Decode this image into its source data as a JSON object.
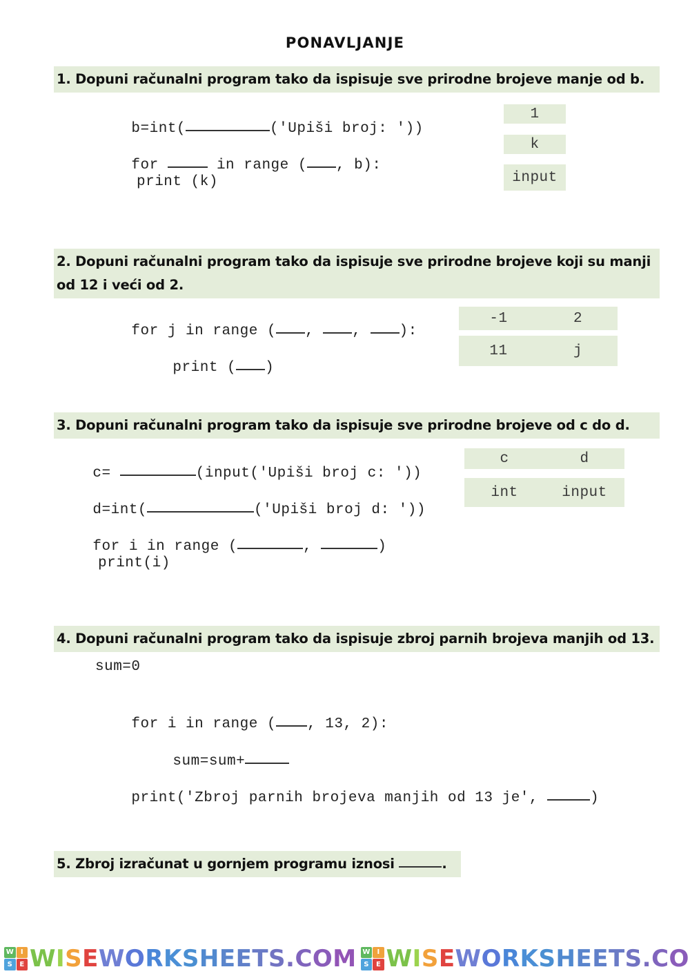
{
  "document": {
    "title": "PONAVLJANJE"
  },
  "questions": [
    {
      "id": "q1",
      "heading": "1. Dopuni računalni program tako da ispisuje sve prirodne brojeve manje od b.",
      "code": [
        {
          "pre": "b=int(",
          "blank": 1,
          "post": "('Upiši broj: '))"
        },
        {
          "pre": "for ",
          "blank": 2,
          "mid": " in range (",
          "blank2": 3,
          "post": ", b):"
        },
        {
          "pre": "    print (k)"
        }
      ],
      "answers": [
        "1",
        "k",
        "input"
      ]
    },
    {
      "id": "q2",
      "heading": "2. Dopuni računalni program tako da ispisuje sve prirodne brojeve koji su manji od 12 i veći od 2.",
      "answers_rows": [
        [
          "-1",
          "2"
        ],
        [
          "11",
          "j"
        ]
      ]
    },
    {
      "id": "q3",
      "heading": "3. Dopuni računalni program tako da ispisuje sve prirodne brojeve od c do d.",
      "answers_rows": [
        [
          "c",
          "d"
        ],
        [
          "int",
          "input"
        ]
      ]
    },
    {
      "id": "q4",
      "heading": "4. Dopuni računalni program tako da ispisuje zbroj parnih brojeva manjih od 13."
    },
    {
      "id": "q5",
      "heading_pre": "5. Zbroj izračunat u gornjem programu iznosi ",
      "heading_post": "."
    }
  ],
  "code": {
    "q1_line1_pre": "b=int(",
    "q1_line1_post": "('Upiši broj: '))",
    "q1_line2_pre": "for ",
    "q1_line2_mid": " in range (",
    "q1_line2_post": ", b):",
    "q1_line3": "print (k)",
    "q2_line1_pre": "for j in range (",
    "q2_line1_sep1": ", ",
    "q2_line1_sep2": ", ",
    "q2_line1_post": "):",
    "q2_line2_pre": "print (",
    "q2_line2_post": ")",
    "q3_line1_pre": "c= ",
    "q3_line1_post": "(input('Upiši broj c: '))",
    "q3_line2_pre": "d=int(",
    "q3_line2_post": "('Upiši broj d: '))",
    "q3_line3_pre": "for i in range (",
    "q3_line3_sep": ", ",
    "q3_line3_post": ")",
    "q3_line4": "print(i)",
    "q4_line1": "sum=0",
    "q4_line2_pre": "for i in range (",
    "q4_line2_post": ", 13, 2):",
    "q4_line3_pre": "sum=sum+",
    "q4_line4_pre": "print('Zbroj parnih brojeva manjih od 13 je', ",
    "q4_line4_post": ")"
  },
  "answers": {
    "q1_a1": "1",
    "q1_a2": "k",
    "q1_a3": "input",
    "q2_r1c1": "-1",
    "q2_r1c2": "2",
    "q2_r2c1": "11",
    "q2_r2c2": "j",
    "q3_r1c1": "c",
    "q3_r1c2": "d",
    "q3_r2c1": "int",
    "q3_r2c2": "input"
  },
  "footer": {
    "watermark_text": "WISEWORKSHEETS.COM",
    "logo_letters": [
      "W",
      "I",
      "S",
      "E"
    ]
  },
  "colors": {
    "highlight": "#e4edda",
    "text": "#111111",
    "code_text": "#222222"
  }
}
